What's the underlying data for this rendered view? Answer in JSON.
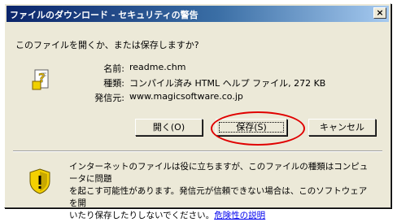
{
  "window": {
    "title": "ファイルのダウンロード - セキュリティの警告",
    "close_label": "×"
  },
  "prompt": "このファイルを開くか、または保存しますか?",
  "file_info": {
    "name_label": "名前:",
    "name_value": "readme.chm",
    "type_label": "種類:",
    "type_value": "コンパイル済み HTML ヘルプ ファイル, 272 KB",
    "from_label": "発信元:",
    "from_value": "www.magicsoftware.co.jp"
  },
  "buttons": {
    "open": "開く(O)",
    "save": "保存(S)",
    "cancel": "キャンセル"
  },
  "warning": {
    "text_line1": "インターネットのファイルは役に立ちますが、このファイルの種類はコンピュータに問題",
    "text_line2": "を起こす可能性があります。発信元が信頼できない場合は、このソフトウェアを開",
    "text_line3": "いたり保存したりしないでください。",
    "link": "危険性の説明"
  },
  "icons": {
    "file": "help-file-icon",
    "warning": "shield-warning-icon",
    "close": "close-icon"
  },
  "colors": {
    "title_bar_start": "#0a246a",
    "title_bar_end": "#a6caf0",
    "dialog_bg": "#ece9d8",
    "highlight_ring": "#e00000",
    "link": "#0000ee"
  }
}
